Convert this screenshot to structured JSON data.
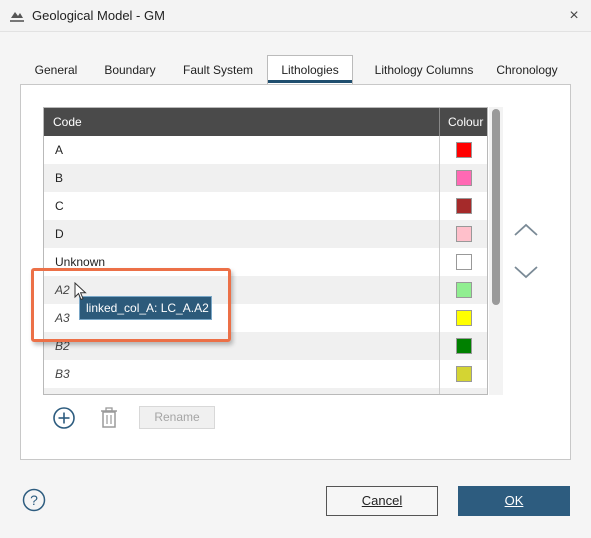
{
  "window": {
    "title": "Geological Model - GM",
    "close_icon": "×"
  },
  "tabs": [
    {
      "label": "General",
      "active": false
    },
    {
      "label": "Boundary",
      "active": false
    },
    {
      "label": "Fault System",
      "active": false
    },
    {
      "label": "Lithologies",
      "active": true
    },
    {
      "label": "Lithology Columns",
      "active": false
    },
    {
      "label": "Chronology",
      "active": false
    }
  ],
  "table": {
    "headers": {
      "code": "Code",
      "colour": "Colour"
    },
    "rows": [
      {
        "code": "A",
        "colour": "#ff0000",
        "italic": false
      },
      {
        "code": "B",
        "colour": "#ff69b4",
        "italic": false
      },
      {
        "code": "C",
        "colour": "#a52a2a",
        "italic": false
      },
      {
        "code": "D",
        "colour": "#ffc0cb",
        "italic": false
      },
      {
        "code": "Unknown",
        "colour": "#ffffff",
        "italic": false
      },
      {
        "code": "A2",
        "colour": "#90ee90",
        "italic": true
      },
      {
        "code": "A3",
        "colour": "#ffff00",
        "italic": true
      },
      {
        "code": "B2",
        "colour": "#008000",
        "italic": true
      },
      {
        "code": "B3",
        "colour": "#d4d433",
        "italic": true
      },
      {
        "code": "",
        "colour": "#66dd66",
        "italic": true
      }
    ]
  },
  "tooltip": {
    "text": "linked_col_A: LC_A.A2"
  },
  "actions": {
    "rename_label": "Rename",
    "add_icon": "add-icon",
    "delete_icon": "trash-icon",
    "move_up_icon": "chevron-up-icon",
    "move_down_icon": "chevron-down-icon"
  },
  "footer": {
    "help_label": "?",
    "cancel_label": "Cancel",
    "ok_label": "OK"
  },
  "colors": {
    "accent": "#2d5c7f",
    "header_bg": "#4a4a4a",
    "highlight": "#ec7047"
  }
}
